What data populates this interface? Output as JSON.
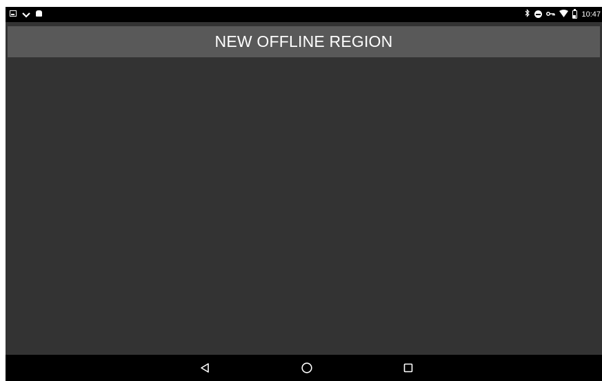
{
  "status_bar": {
    "left_icons": [
      "image-icon",
      "download-icon",
      "android-icon"
    ],
    "right_icons": [
      "bluetooth-icon",
      "do-not-disturb-icon",
      "vpn-key-icon",
      "wifi-icon",
      "battery-icon"
    ],
    "time": "10:47"
  },
  "app_bar": {
    "title": "NEW OFFLINE REGION"
  },
  "nav_bar": {
    "icons": [
      "back-icon",
      "home-icon",
      "recents-icon"
    ]
  },
  "colors": {
    "status_bar": "#000000",
    "app_bar": "#595959",
    "content_background": "#333333",
    "nav_bar": "#000000",
    "text": "#ffffff"
  }
}
